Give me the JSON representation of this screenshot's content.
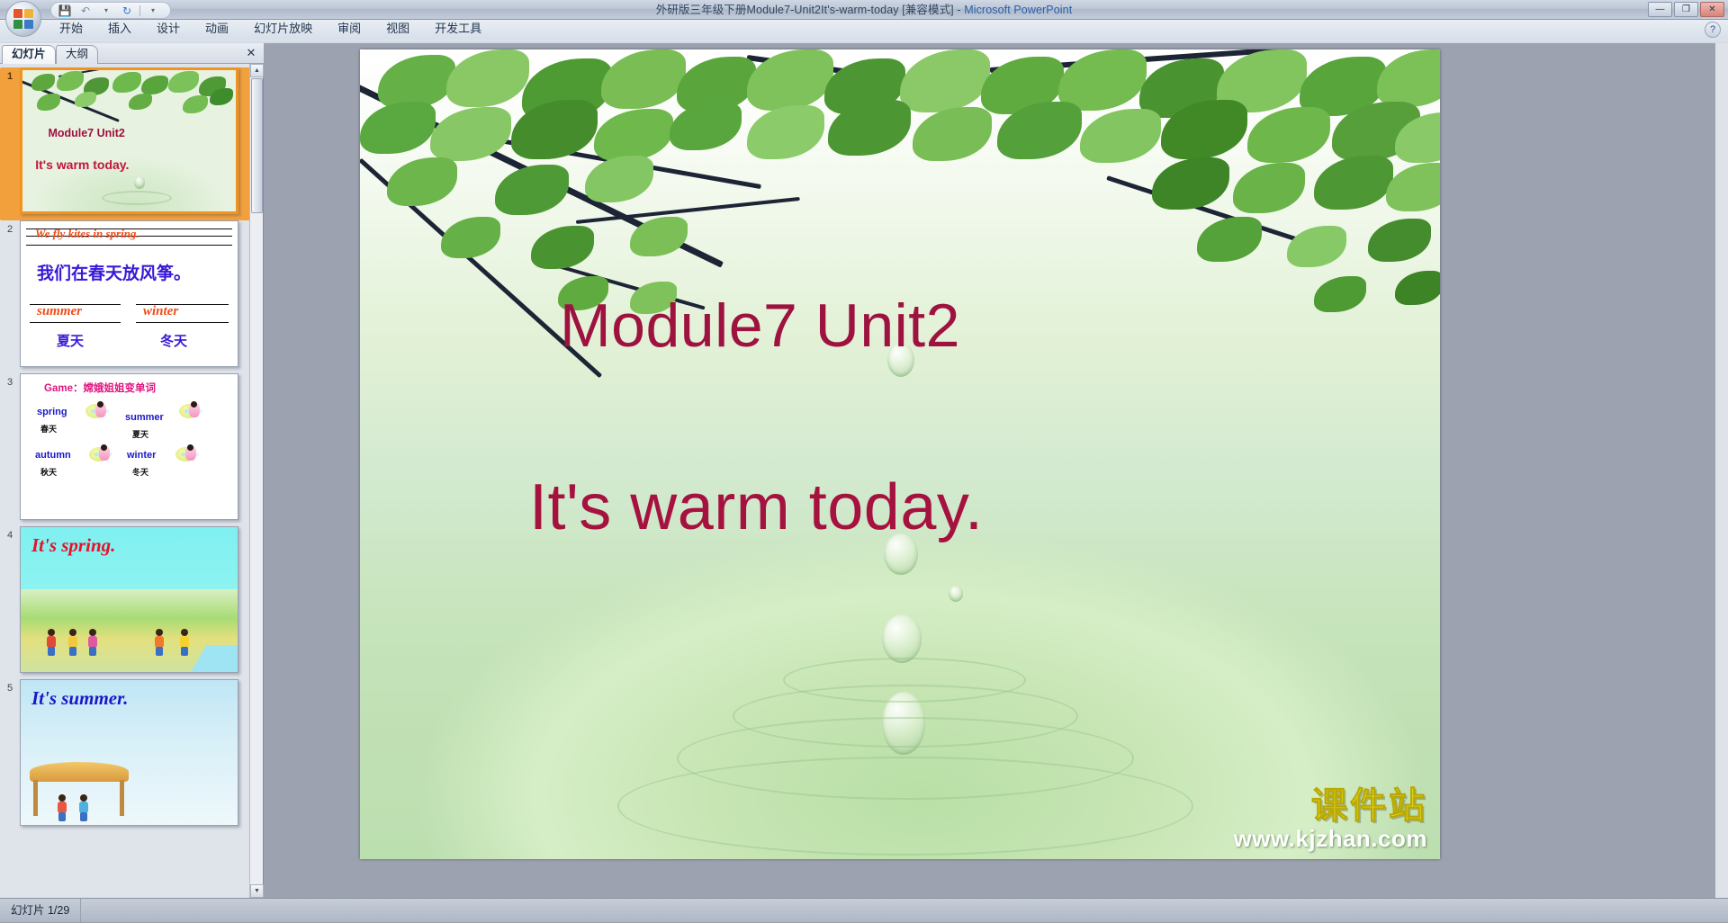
{
  "window": {
    "title_document": "外研版三年级下册Module7-Unit2It's-warm-today [兼容模式]",
    "title_sep": "  -  ",
    "title_app": "Microsoft PowerPoint",
    "minimize": "—",
    "restore": "❐",
    "close": "✕",
    "help": "?"
  },
  "quick_access": {
    "office_button": "office-button",
    "save": "💾",
    "undo": "↶",
    "undo_caret": "▾",
    "redo": "↻",
    "customize": "▾"
  },
  "ribbon": {
    "tabs": [
      {
        "label": "开始"
      },
      {
        "label": "插入"
      },
      {
        "label": "设计"
      },
      {
        "label": "动画"
      },
      {
        "label": "幻灯片放映"
      },
      {
        "label": "审阅"
      },
      {
        "label": "视图"
      },
      {
        "label": "开发工具"
      }
    ]
  },
  "left_pane": {
    "tabs": [
      {
        "label": "幻灯片",
        "selected": true
      },
      {
        "label": "大纲",
        "selected": false
      }
    ],
    "close_label": "✕",
    "scroll_up": "▲",
    "scroll_down": "▼",
    "thumbnails": [
      {
        "number": "1",
        "selected": true,
        "title": "Module7 Unit2",
        "subtitle": "It's warm today."
      },
      {
        "number": "2",
        "selected": false,
        "english": "We fly kites in spring.",
        "chinese": "我们在春天放风筝。",
        "word_left_en": "summer",
        "word_left_cn": "夏天",
        "word_right_en": "winter",
        "word_right_cn": "冬天"
      },
      {
        "number": "3",
        "selected": false,
        "title_prefix": "Game：",
        "title_cn": "嫦娥姐姐变单词",
        "items": [
          {
            "en": "spring",
            "cn": "春天"
          },
          {
            "en": "summer",
            "cn": "夏天"
          },
          {
            "en": "autumn",
            "cn": "秋天"
          },
          {
            "en": "winter",
            "cn": "冬天"
          }
        ]
      },
      {
        "number": "4",
        "selected": false,
        "title": "It's spring."
      },
      {
        "number": "5",
        "selected": false,
        "title": "It's summer."
      }
    ]
  },
  "slide": {
    "title": "Module7 Unit2",
    "subtitle": "It's warm today.",
    "watermark_cn": "课件站",
    "watermark_url": "www.kjzhan.com"
  },
  "status_bar": {
    "slide_counter": "幻灯片 1/29"
  },
  "colors": {
    "title_red": "#9e1240",
    "subtitle_red": "#a6123f",
    "selected_thumb_border": "#f0941f",
    "watermark_yellow": "#f2e11a",
    "app_blue": "#2b5ea8"
  }
}
